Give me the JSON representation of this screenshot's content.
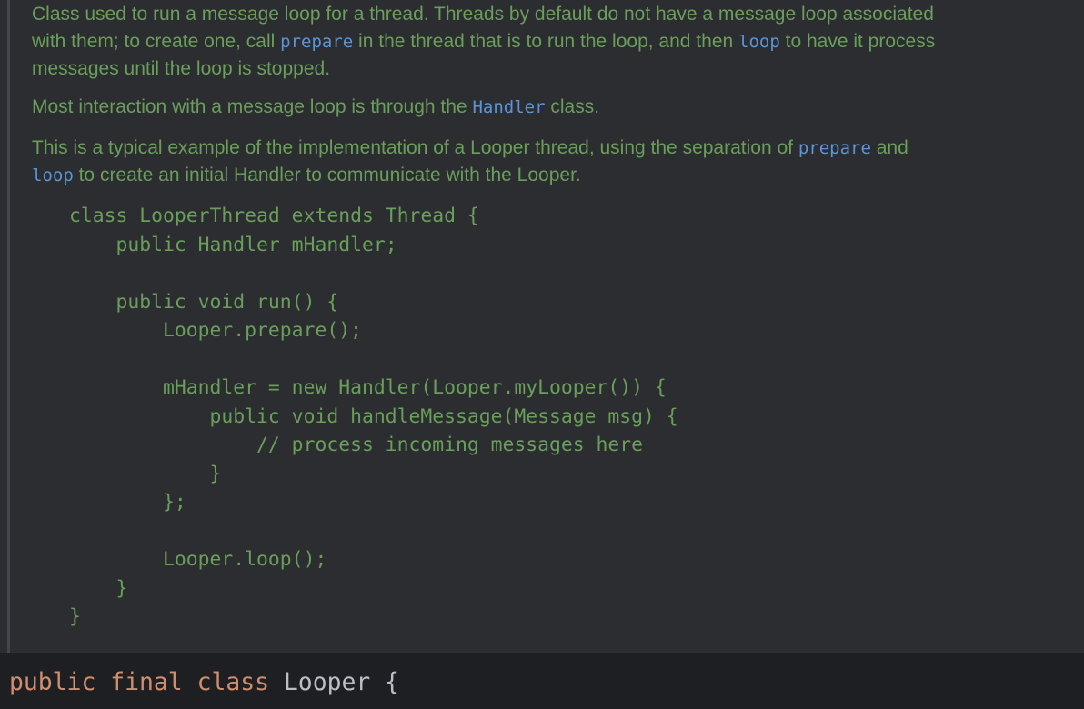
{
  "doc": {
    "p1": {
      "l1": "Class used to run a message loop for a thread. Threads by default do not have a message loop associated",
      "l2a": "with them; to create one, call ",
      "l2ref1": "prepare",
      "l2b": " in the thread that is to run the loop, and then ",
      "l2ref2": "loop",
      "l2c": " to have it process",
      "l3": "messages until the loop is stopped."
    },
    "p2": {
      "a": "Most interaction with a message loop is through the ",
      "ref": "Handler",
      "b": " class."
    },
    "p3": {
      "l1a": "This is a typical example of the implementation of a Looper thread, using the separation of ",
      "l1ref": "prepare",
      "l1b": " and",
      "l2ref": "loop",
      "l2b": " to create an initial Handler to communicate with the Looper."
    },
    "code_lines": [
      "class LooperThread extends Thread {",
      "    public Handler mHandler;",
      "",
      "    public void run() {",
      "        Looper.prepare();",
      "",
      "        mHandler = new Handler(Looper.myLooper()) {",
      "            public void handleMessage(Message msg) {",
      "                // process incoming messages here",
      "            }",
      "        };",
      "",
      "        Looper.loop();",
      "    }",
      "}"
    ]
  },
  "declaration": {
    "kw_public": "public",
    "kw_final": "final",
    "kw_class": "class",
    "name": "Looper",
    "brace": "{"
  },
  "colors": {
    "background": "#1e1f22",
    "doc_background": "#2b2d30",
    "doc_text": "#6a9e5a",
    "doc_link": "#5c95d6",
    "keyword": "#cf8e6d",
    "identifier": "#bcbec4"
  }
}
